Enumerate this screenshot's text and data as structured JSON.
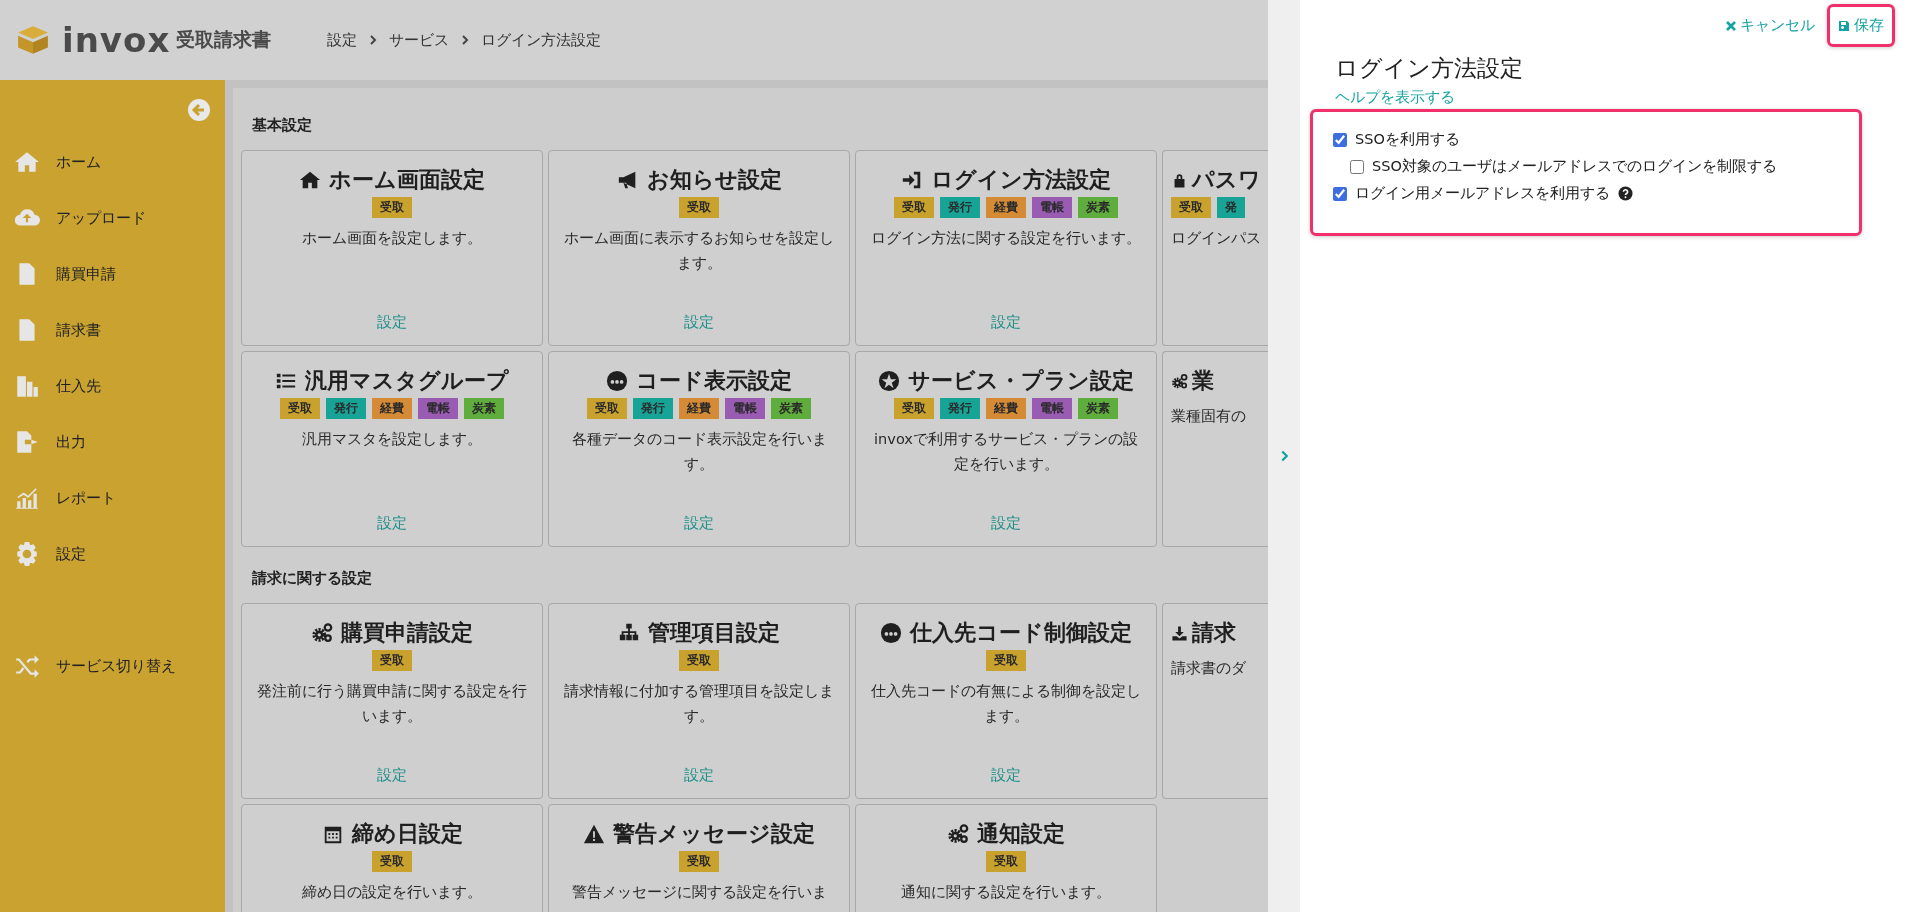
{
  "header": {
    "logo_text": "invox",
    "product": "受取請求書",
    "breadcrumb": [
      "設定",
      "サービス",
      "ログイン方法設定"
    ]
  },
  "sidebar": {
    "items": [
      {
        "label": "ホーム"
      },
      {
        "label": "アップロード"
      },
      {
        "label": "購買申請"
      },
      {
        "label": "請求書"
      },
      {
        "label": "仕入先"
      },
      {
        "label": "出力"
      },
      {
        "label": "レポート"
      },
      {
        "label": "設定"
      }
    ],
    "footer_item": {
      "label": "サービス切り替え"
    }
  },
  "sections": [
    {
      "heading": "基本設定",
      "cards": [
        {
          "kind": "full",
          "title": "ホーム画面設定",
          "badges": [
            {
              "label": "受取",
              "color": "#c9a22e"
            }
          ],
          "description": "ホーム画面を設定します。",
          "link": "設定"
        },
        {
          "kind": "full",
          "title": "お知らせ設定",
          "badges": [
            {
              "label": "受取",
              "color": "#c9a22e"
            }
          ],
          "description": "ホーム画面に表示するお知らせを設定します。",
          "link": "設定"
        },
        {
          "kind": "full",
          "title": "ログイン方法設定",
          "badges": [
            {
              "label": "受取",
              "color": "#c9a22e"
            },
            {
              "label": "発行",
              "color": "#17a497"
            },
            {
              "label": "経費",
              "color": "#d58a35"
            },
            {
              "label": "電帳",
              "color": "#9a5bb3"
            },
            {
              "label": "炭素",
              "color": "#5fad3c"
            }
          ],
          "description": "ログイン方法に関する設定を行います。",
          "link": "設定"
        },
        {
          "kind": "partial",
          "title": "パスワ",
          "badges": [
            {
              "label": "受取",
              "color": "#c9a22e"
            },
            {
              "label": "発",
              "color": "#17a497"
            }
          ],
          "description": "ログインパス"
        },
        {
          "kind": "full",
          "title": "汎用マスタグループ",
          "badges": [
            {
              "label": "受取",
              "color": "#c9a22e"
            },
            {
              "label": "発行",
              "color": "#17a497"
            },
            {
              "label": "経費",
              "color": "#d58a35"
            },
            {
              "label": "電帳",
              "color": "#9a5bb3"
            },
            {
              "label": "炭素",
              "color": "#5fad3c"
            }
          ],
          "description": "汎用マスタを設定します。",
          "link": "設定"
        },
        {
          "kind": "full",
          "title": "コード表示設定",
          "badges": [
            {
              "label": "受取",
              "color": "#c9a22e"
            },
            {
              "label": "発行",
              "color": "#17a497"
            },
            {
              "label": "経費",
              "color": "#d58a35"
            },
            {
              "label": "電帳",
              "color": "#9a5bb3"
            },
            {
              "label": "炭素",
              "color": "#5fad3c"
            }
          ],
          "description": "各種データのコード表示設定を行います。",
          "link": "設定"
        },
        {
          "kind": "full",
          "title": "サービス・プラン設定",
          "badges": [
            {
              "label": "受取",
              "color": "#c9a22e"
            },
            {
              "label": "発行",
              "color": "#17a497"
            },
            {
              "label": "経費",
              "color": "#d58a35"
            },
            {
              "label": "電帳",
              "color": "#9a5bb3"
            },
            {
              "label": "炭素",
              "color": "#5fad3c"
            }
          ],
          "description": "invoxで利用するサービス・プランの設定を行います。",
          "link": "設定"
        },
        {
          "kind": "partial",
          "title": "業",
          "description": "業種固有の"
        }
      ]
    },
    {
      "heading": "請求に関する設定",
      "cards": [
        {
          "kind": "full",
          "title": "購買申請設定",
          "badges": [
            {
              "label": "受取",
              "color": "#c9a22e"
            }
          ],
          "description": "発注前に行う購買申請に関する設定を行います。",
          "link": "設定"
        },
        {
          "kind": "full",
          "title": "管理項目設定",
          "badges": [
            {
              "label": "受取",
              "color": "#c9a22e"
            }
          ],
          "description": "請求情報に付加する管理項目を設定します。",
          "link": "設定"
        },
        {
          "kind": "full",
          "title": "仕入先コード制御設定",
          "badges": [
            {
              "label": "受取",
              "color": "#c9a22e"
            }
          ],
          "description": "仕入先コードの有無による制御を設定します。",
          "link": "設定"
        },
        {
          "kind": "partial",
          "title": "請求",
          "description": "請求書のダ"
        },
        {
          "kind": "full",
          "title": "締め日設定",
          "badges": [
            {
              "label": "受取",
              "color": "#c9a22e"
            }
          ],
          "description": "締め日の設定を行います。"
        },
        {
          "kind": "full",
          "title": "警告メッセージ設定",
          "badges": [
            {
              "label": "受取",
              "color": "#c9a22e"
            }
          ],
          "description": "警告メッセージに関する設定を行いま"
        },
        {
          "kind": "full",
          "title": "通知設定",
          "badges": [
            {
              "label": "受取",
              "color": "#c9a22e"
            }
          ],
          "description": "通知に関する設定を行います。"
        }
      ]
    }
  ],
  "panel": {
    "cancel": "キャンセル",
    "save": "保存",
    "title": "ログイン方法設定",
    "help_link": "ヘルプを表示する",
    "options": [
      {
        "label": "SSOを利用する",
        "checked": true,
        "help_icon": false,
        "children": [
          {
            "label": "SSO対象のユーザはメールアドレスでのログインを制限する",
            "checked": false,
            "help_icon": false
          }
        ]
      },
      {
        "label": "ログイン用メールアドレスを利用する",
        "checked": true,
        "help_icon": true
      }
    ]
  }
}
